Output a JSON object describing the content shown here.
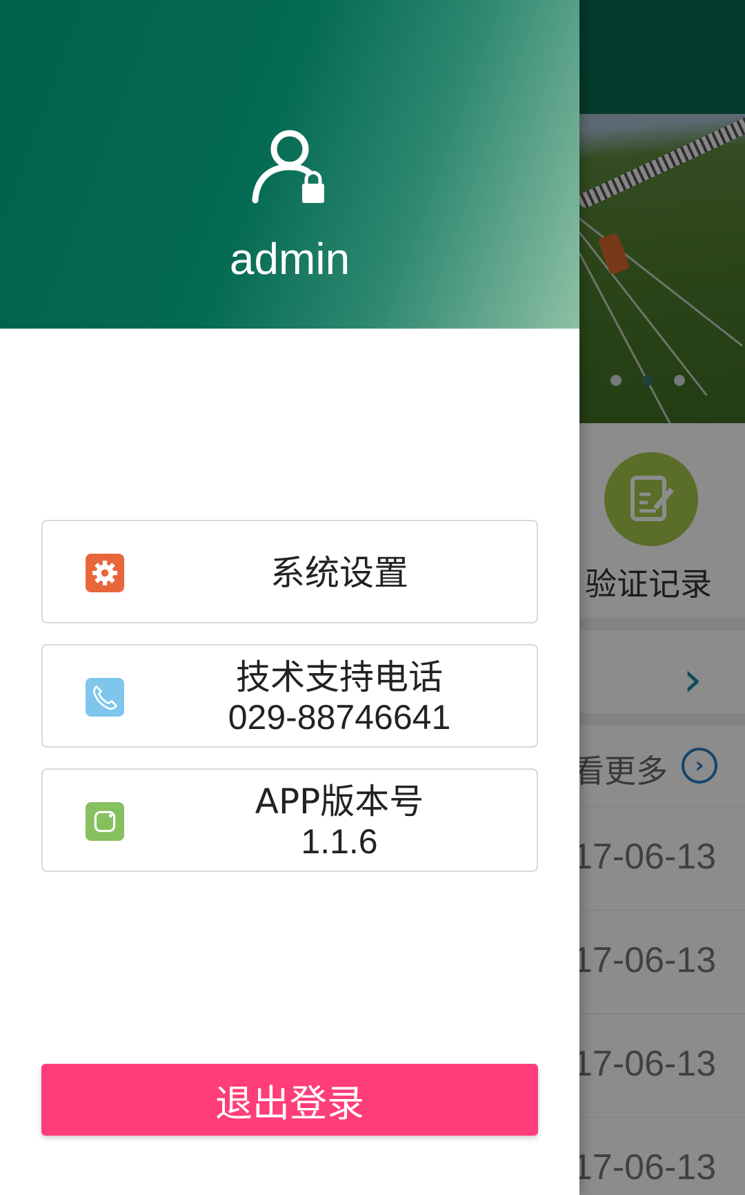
{
  "drawer": {
    "username": "admin",
    "menu": [
      {
        "line1": "系统设置",
        "line2": "",
        "icon": "gear-icon",
        "icon_color": "#e8673a"
      },
      {
        "line1": "技术支持电话",
        "line2": "029-88746641",
        "icon": "phone-icon",
        "icon_color": "#7fc6ec"
      },
      {
        "line1": "APP版本号",
        "line2": "1.1.6",
        "icon": "app-version-icon",
        "icon_color": "#86c05f"
      }
    ],
    "logout_label": "退出登录"
  },
  "background": {
    "feature_label": "验证记录",
    "view_more_label": "看更多",
    "dates": [
      "17-06-13",
      "17-06-13",
      "17-06-13",
      "17-06-13"
    ]
  },
  "colors": {
    "header_dark": "#02614b",
    "header_light": "#8ec0a5",
    "logout": "#ff3d7a",
    "feature_circle": "#a4c64b"
  }
}
